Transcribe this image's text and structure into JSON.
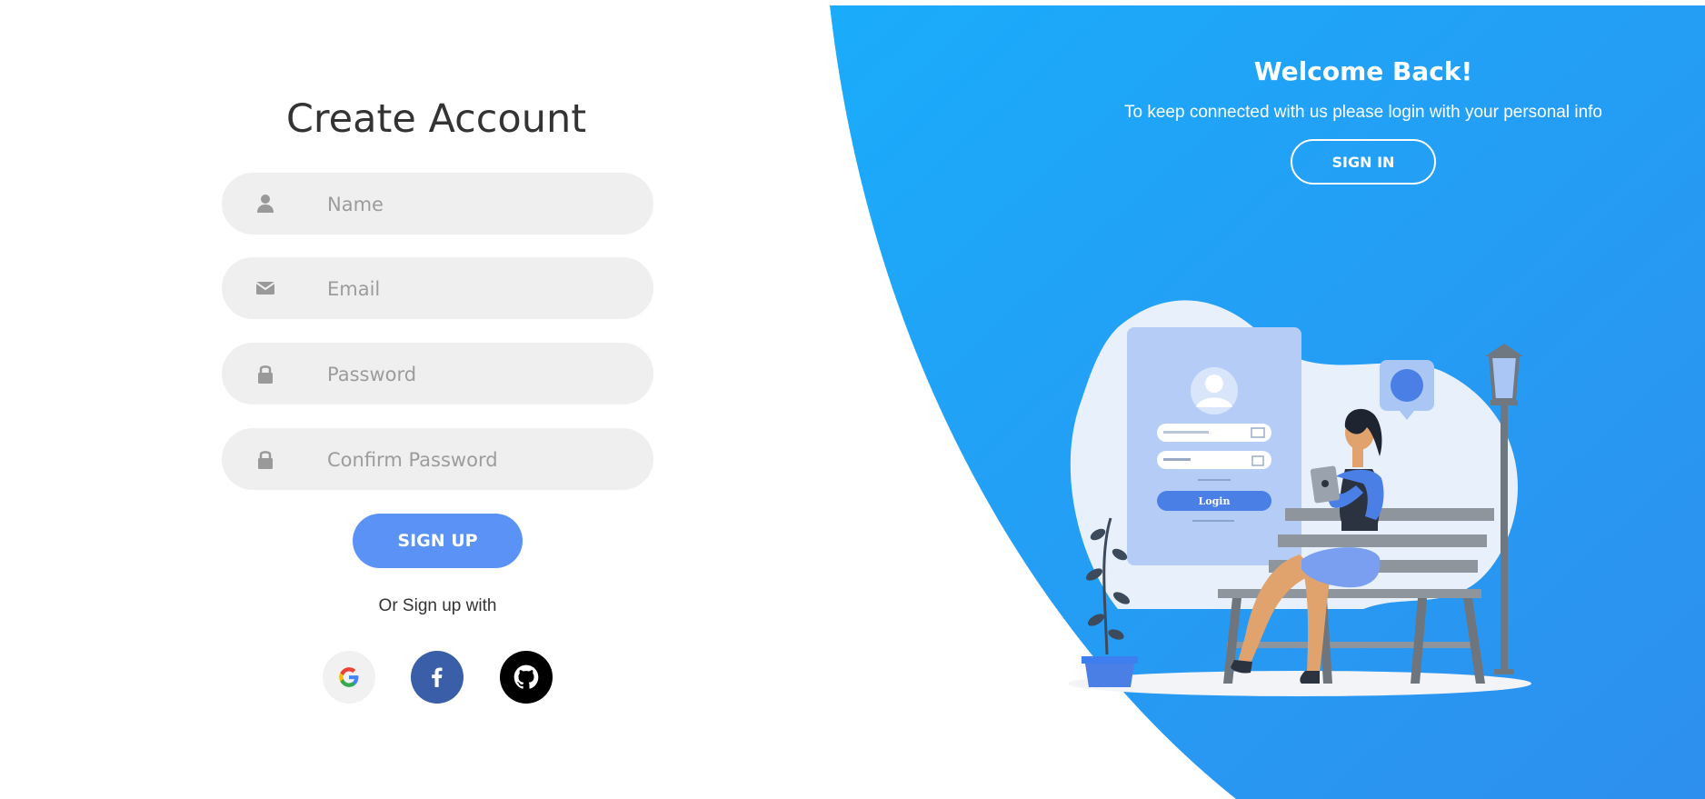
{
  "colors": {
    "accent_blue": "#5a92f5",
    "panel_gradient_start": "#1aacfb",
    "panel_gradient_end": "#2e8fee",
    "field_bg": "#efefef",
    "facebook_blue": "#3b5ea8",
    "github_black": "#000000"
  },
  "signup_form": {
    "title": "Create Account",
    "fields": [
      {
        "icon": "user-icon",
        "placeholder": "Name",
        "type": "text"
      },
      {
        "icon": "envelope-icon",
        "placeholder": "Email",
        "type": "email"
      },
      {
        "icon": "lock-icon",
        "placeholder": "Password",
        "type": "password"
      },
      {
        "icon": "lock-icon",
        "placeholder": "Confirm Password",
        "type": "password"
      }
    ],
    "submit_label": "SIGN UP",
    "alt_text": "Or Sign up with",
    "social": [
      {
        "icon": "google-icon"
      },
      {
        "icon": "facebook-icon"
      },
      {
        "icon": "github-icon"
      }
    ]
  },
  "welcome_panel": {
    "title": "Welcome Back!",
    "subtitle": "To keep connected with us please login with your personal info",
    "button_label": "SIGN IN"
  },
  "illustration": {
    "login_card_button": "Login"
  }
}
